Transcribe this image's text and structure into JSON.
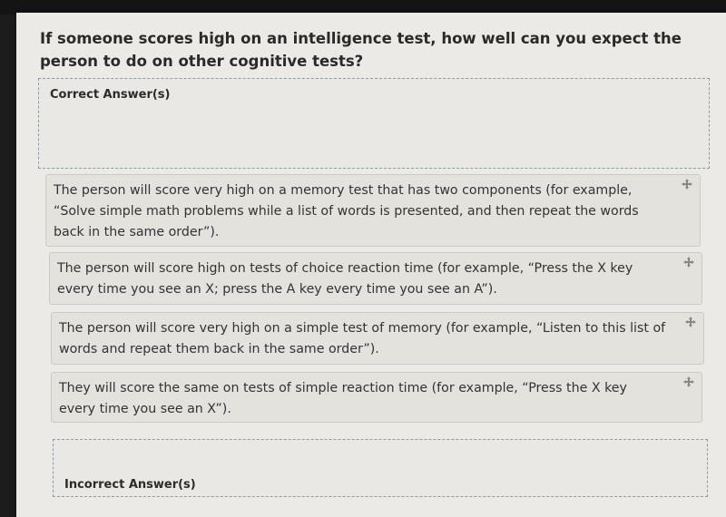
{
  "question": {
    "text": "If someone scores high on an intelligence test, how well can you expect the person to do on other cognitive tests?"
  },
  "correct_zone": {
    "label": "Correct Answer(s)"
  },
  "incorrect_zone": {
    "label": "Incorrect Answer(s)"
  },
  "answer_cards": [
    {
      "text": "The person will score very high on a memory test that has two components (for example, “Solve simple math problems while a list of words is presented, and then repeat the words back in the same order”).",
      "icon": "move-icon"
    },
    {
      "text": "The person will score high on tests of choice reaction time (for example, “Press the X key every time you see an X; press the A key every time you see an A”).",
      "icon": "move-icon"
    },
    {
      "text": "The person will score very high on a simple test of memory (for example, “Listen to this list of words and repeat them back in the same order”).",
      "icon": "move-icon"
    },
    {
      "text": "They will score the same on tests of simple reaction time (for example, “Press the X key every time you see an X”).",
      "icon": "move-icon"
    }
  ]
}
